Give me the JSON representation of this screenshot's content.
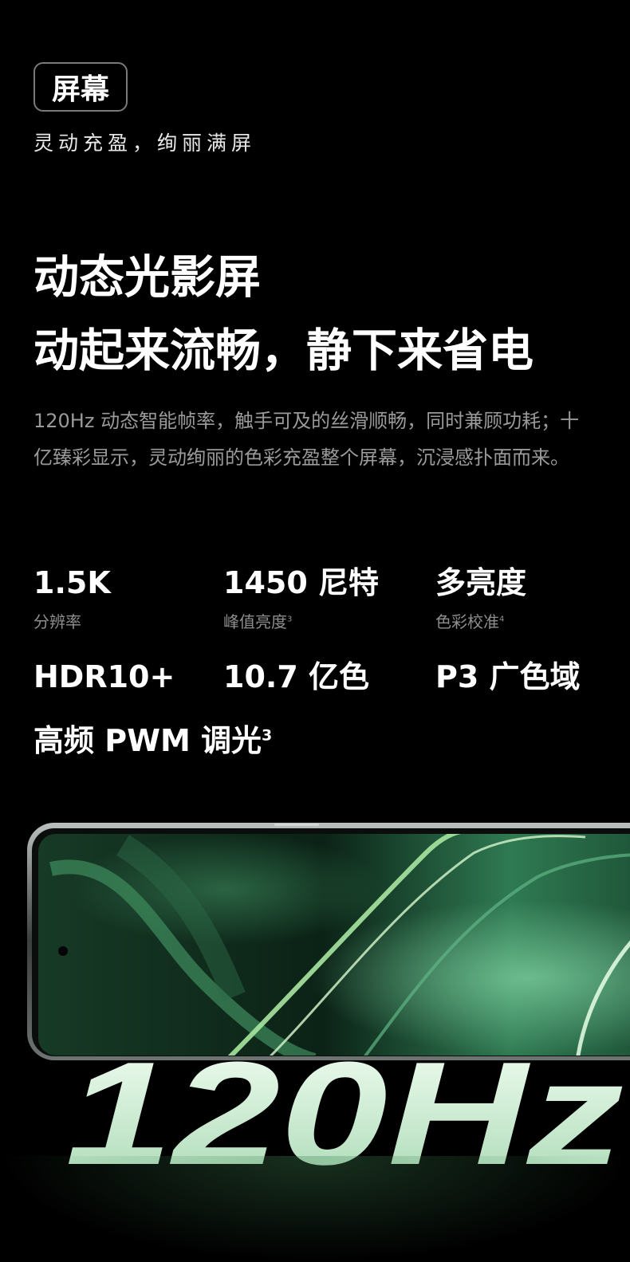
{
  "section": {
    "tag": "屏幕",
    "tagline": "灵动充盈，绚丽满屏"
  },
  "headline": {
    "line1": "动态光影屏",
    "line2": "动起来流畅，静下来省电"
  },
  "description": "120Hz 动态智能帧率，触手可及的丝滑顺畅，同时兼顾功耗；十亿臻彩显示，灵动绚丽的色彩充盈整个屏幕，沉浸感扑面而来。",
  "specs": [
    {
      "value": "1.5K",
      "label": "分辨率",
      "label_sup": ""
    },
    {
      "value": "1450 尼特",
      "label": "峰值亮度",
      "label_sup": "3"
    },
    {
      "value": "多亮度",
      "label": "色彩校准",
      "label_sup": "4"
    },
    {
      "value": "HDR10+",
      "label": "",
      "label_sup": ""
    },
    {
      "value": "10.7 亿色",
      "label": "",
      "label_sup": ""
    },
    {
      "value": "P3 广色域",
      "label": "",
      "label_sup": ""
    },
    {
      "value": "高频 PWM 调光",
      "value_sup": "3"
    }
  ],
  "hero_text": "120Hz",
  "colors": {
    "background": "#000000",
    "accent_green": "#3f9a66",
    "hero_text": "#dff3e2"
  }
}
